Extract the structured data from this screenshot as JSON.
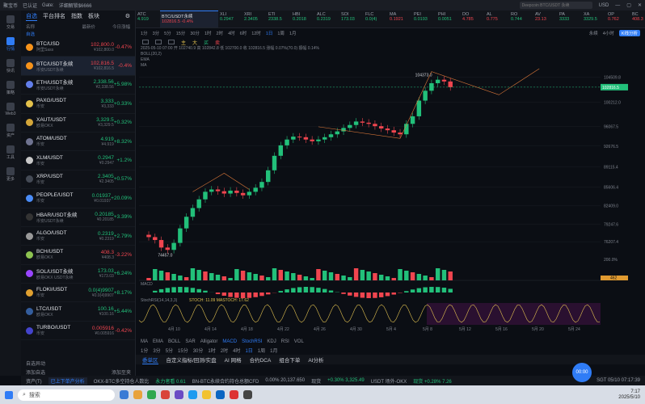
{
  "titlebar": {
    "app": "聚宝币",
    "tag": "已认证",
    "gate_label": "Gate:",
    "gate_sub": "详细解锁$6666",
    "search_placeholder": "Deepcoin BTC/USDT 永续",
    "currency": "USD"
  },
  "leftnav": [
    {
      "label": "交易",
      "icon": "exchange-icon"
    },
    {
      "label": "行情",
      "icon": "market-icon",
      "active": true
    },
    {
      "label": "快讯",
      "icon": "news-icon"
    },
    {
      "label": "策略",
      "icon": "strategy-icon"
    },
    {
      "label": "Web3",
      "icon": "web3-icon"
    },
    {
      "label": "资产",
      "icon": "wallet-icon"
    },
    {
      "label": "工具",
      "icon": "tools-icon"
    },
    {
      "label": "更多",
      "icon": "more-icon"
    }
  ],
  "watch": {
    "tabs": [
      "自选",
      "平台排名",
      "指数",
      "板块"
    ],
    "head": {
      "name": "名称",
      "price": "最新价",
      "change": "今日涨幅"
    },
    "group": "自选",
    "rows": [
      {
        "sym": "BTC/USD",
        "sub": "阿里Sass",
        "price": "102,800.0",
        "cny": "¥102,800.0",
        "chg": "-0.47%",
        "dir": "dn",
        "color": "#f7931a"
      },
      {
        "sym": "BTC/USDT永续",
        "sub": "币安USDT永续",
        "price": "102,816.5",
        "cny": "¥102,816.5",
        "chg": "-0.4%",
        "dir": "dn",
        "color": "#f7931a",
        "selected": true
      },
      {
        "sym": "ETH/USDT永续",
        "sub": "币安USDT永续",
        "price": "2,338.56",
        "cny": "¥2,338.56",
        "chg": "+5.98%",
        "dir": "up",
        "color": "#627eea"
      },
      {
        "sym": "PAXG/USDT",
        "sub": "币安",
        "price": "3,333",
        "cny": "¥3,333",
        "chg": "+0.33%",
        "dir": "up",
        "color": "#e4c14b"
      },
      {
        "sym": "XAUT/USDT",
        "sub": "欧易OKX",
        "price": "3,329.5",
        "cny": "¥3,329.5",
        "chg": "+0.32%",
        "dir": "up",
        "color": "#d4a63a"
      },
      {
        "sym": "ATOM/USDT",
        "sub": "币安",
        "price": "4.919",
        "cny": "¥4.919",
        "chg": "+8.32%",
        "dir": "up",
        "color": "#6f7390"
      },
      {
        "sym": "XLM/USDT",
        "sub": "币安",
        "price": "0.2947",
        "cny": "¥0.2947",
        "chg": "+1.2%",
        "dir": "up",
        "color": "#c9c9c9"
      },
      {
        "sym": "XRP/USDT",
        "sub": "币安",
        "price": "2.3405",
        "cny": "¥2.3405",
        "chg": "+0.57%",
        "dir": "up",
        "color": "#444a55"
      },
      {
        "sym": "PEOPLE/USDT",
        "sub": "币安",
        "price": "0.01937",
        "cny": "¥0.01937",
        "chg": "+20.09%",
        "dir": "up",
        "color": "#4a8cf7"
      },
      {
        "sym": "HBAR/USDT永续",
        "sub": "币安USDT永续",
        "price": "0.20185",
        "cny": "¥0.20185",
        "chg": "+3.39%",
        "dir": "up",
        "color": "#333"
      },
      {
        "sym": "ALGO/USDT",
        "sub": "币安",
        "price": "0.2319",
        "cny": "¥0.2319",
        "chg": "+2.79%",
        "dir": "up",
        "color": "#999"
      },
      {
        "sym": "BCH/USDT",
        "sub": "欧易OKX",
        "price": "408.3",
        "cny": "¥408.3",
        "chg": "-3.22%",
        "dir": "dn",
        "color": "#8dc351"
      },
      {
        "sym": "SOL/USDT永续",
        "sub": "欧易OKX USDT永续",
        "price": "173.03",
        "cny": "¥173.03",
        "chg": "+6.24%",
        "dir": "up",
        "color": "#9945ff"
      },
      {
        "sym": "FLOKI/USDT",
        "sub": "币安",
        "price": "0.0(4)9907",
        "cny": "¥0.0(4)9907",
        "chg": "+8.17%",
        "dir": "up",
        "color": "#e0a030"
      },
      {
        "sym": "LTC/USDT",
        "sub": "欧易OKX",
        "price": "100.16",
        "cny": "¥100.16",
        "chg": "+5.44%",
        "dir": "up",
        "color": "#345d9d"
      },
      {
        "sym": "TURBO/USDT",
        "sub": "币安",
        "price": "0.005916",
        "cny": "¥0.005916",
        "chg": "-0.42%",
        "dir": "dn",
        "color": "#44c"
      }
    ],
    "footer": {
      "left": "自选异动",
      "add": "添加自选",
      "manage": "添加至夹"
    }
  },
  "tickers": [
    {
      "name": "ATC",
      "price": "4.919",
      "dir": "up"
    },
    {
      "name": "BTC/USDT永续",
      "price": "102816.5 -0.4%",
      "dir": "dn",
      "active": true
    },
    {
      "name": "XLI",
      "price": "0.2947",
      "dir": "up"
    },
    {
      "name": "XRI",
      "price": "2.3405",
      "dir": "up"
    },
    {
      "name": "ETI",
      "price": "2338.5",
      "dir": "up"
    },
    {
      "name": "HBI",
      "price": "0.2018",
      "dir": "up"
    },
    {
      "name": "ALC",
      "price": "0.2319",
      "dir": "up"
    },
    {
      "name": "SOI",
      "price": "173.03",
      "dir": "up"
    },
    {
      "name": "FLC",
      "price": "0.0(4)",
      "dir": "up"
    },
    {
      "name": "MA",
      "price": "0.1921",
      "dir": "dn"
    },
    {
      "name": "PEI",
      "price": "0.0193",
      "dir": "up"
    },
    {
      "name": "PHI",
      "price": "0.0051",
      "dir": "up"
    },
    {
      "name": "DO",
      "price": "4.785",
      "dir": "dn"
    },
    {
      "name": "AL",
      "price": "0.775",
      "dir": "dn"
    },
    {
      "name": "RO",
      "price": "0.744",
      "dir": "up"
    },
    {
      "name": "AV",
      "price": "23.13",
      "dir": "dn"
    },
    {
      "name": "PA",
      "price": "3333",
      "dir": "up"
    },
    {
      "name": "XA",
      "price": "3329.5",
      "dir": "up"
    },
    {
      "name": "OP",
      "price": "0.762",
      "dir": "dn"
    },
    {
      "name": "BC",
      "price": "408.3",
      "dir": "dn"
    }
  ],
  "timeframes": [
    "1分",
    "3分",
    "5分",
    "15分",
    "30分",
    "1时",
    "2时",
    "4时",
    "6时",
    "12时",
    "1日",
    "1周",
    "1月"
  ],
  "toolbar_right": {
    "type": "永续",
    "timeframe": "4小时",
    "kline_btn": "K线分析"
  },
  "drawbar": [
    "主",
    "大",
    "买",
    "卖"
  ],
  "chart_info": {
    "line1": "2025-05-10 07:00  开 102740.9  高 102842.8  低 102700.0  收 102816.5  涨幅 0.07%(70.0)  振幅 0.14%",
    "line2": "BOLL(20,2)",
    "line3": "EMA",
    "line4": "MA"
  },
  "chart_data": {
    "type": "candlestick",
    "price_ticks": [
      "104509.8",
      "102816.5",
      "100212.0",
      "96067.5",
      "92676.5",
      "89115.4",
      "85606.4",
      "82409.0",
      "79247.6",
      "76207.4"
    ],
    "last_price": "102816.5",
    "high_label": "104373.0",
    "low_label": "74457.0",
    "x_ticks": [
      "4月 10",
      "4月 14",
      "4月 18",
      "4月 22",
      "4月 26",
      "4月 30",
      "5月 4",
      "5月 8",
      "5月 12",
      "5月 16",
      "5月 20",
      "5月 24"
    ],
    "closes": [
      77000,
      76500,
      75200,
      74800,
      76000,
      78500,
      80500,
      82000,
      83500,
      84800,
      85200,
      84900,
      84500,
      85000,
      84600,
      84200,
      84800,
      85500,
      86500,
      88500,
      91000,
      92800,
      93800,
      94300,
      94200,
      93800,
      93500,
      93800,
      94200,
      94700,
      95200,
      95800,
      96300,
      96900,
      96700,
      96500,
      96100,
      95700,
      95400,
      95000,
      94700,
      96500,
      97800,
      100500,
      102200,
      103500,
      104100,
      103800,
      102816.5
    ],
    "volume_ticks": [
      "200.0%",
      "462"
    ],
    "macd_label": "MACD",
    "stoch_label": "StochRSI(14,14,3,3)",
    "stoch_values": "STOCH: 11.09  MASTOCH: 17.62"
  },
  "bottom": {
    "timeframes": [
      "1分",
      "3分",
      "5分",
      "15分",
      "30分",
      "1时",
      "2时",
      "4时",
      "1日",
      "1周",
      "1月"
    ],
    "indicators": [
      "MA",
      "EMA",
      "BOLL",
      "SAR",
      "Alligator",
      "MACD",
      "StochRSI",
      "KDJ",
      "RSI",
      "VOL"
    ],
    "panel_tabs": [
      "委单区",
      "自定义指标/回测/实盘",
      "AI 网格",
      "合约DCA",
      "组合下单",
      "AI分析"
    ]
  },
  "status": {
    "account": "资产(T)",
    "hint": "已上下单产分析",
    "ticker1": "OKX-BTC多空持仓人数比",
    "val1": "永力者看 0.61",
    "ticker2": "BN-BTC永续合约持仓总额CFD",
    "val2": "0.00% 20,137.650",
    "ticker3": "现货",
    "val3": "+0.30% 3,325.49",
    "ticker4": "USDT 场外-OKX",
    "val4": "现货 +0.28% 7.26",
    "server": "SGT 05/10 07:17:39"
  },
  "taskbar": {
    "search": "搜索",
    "time": "7:17",
    "date": "2025/5/10"
  },
  "bubble": "00:00"
}
